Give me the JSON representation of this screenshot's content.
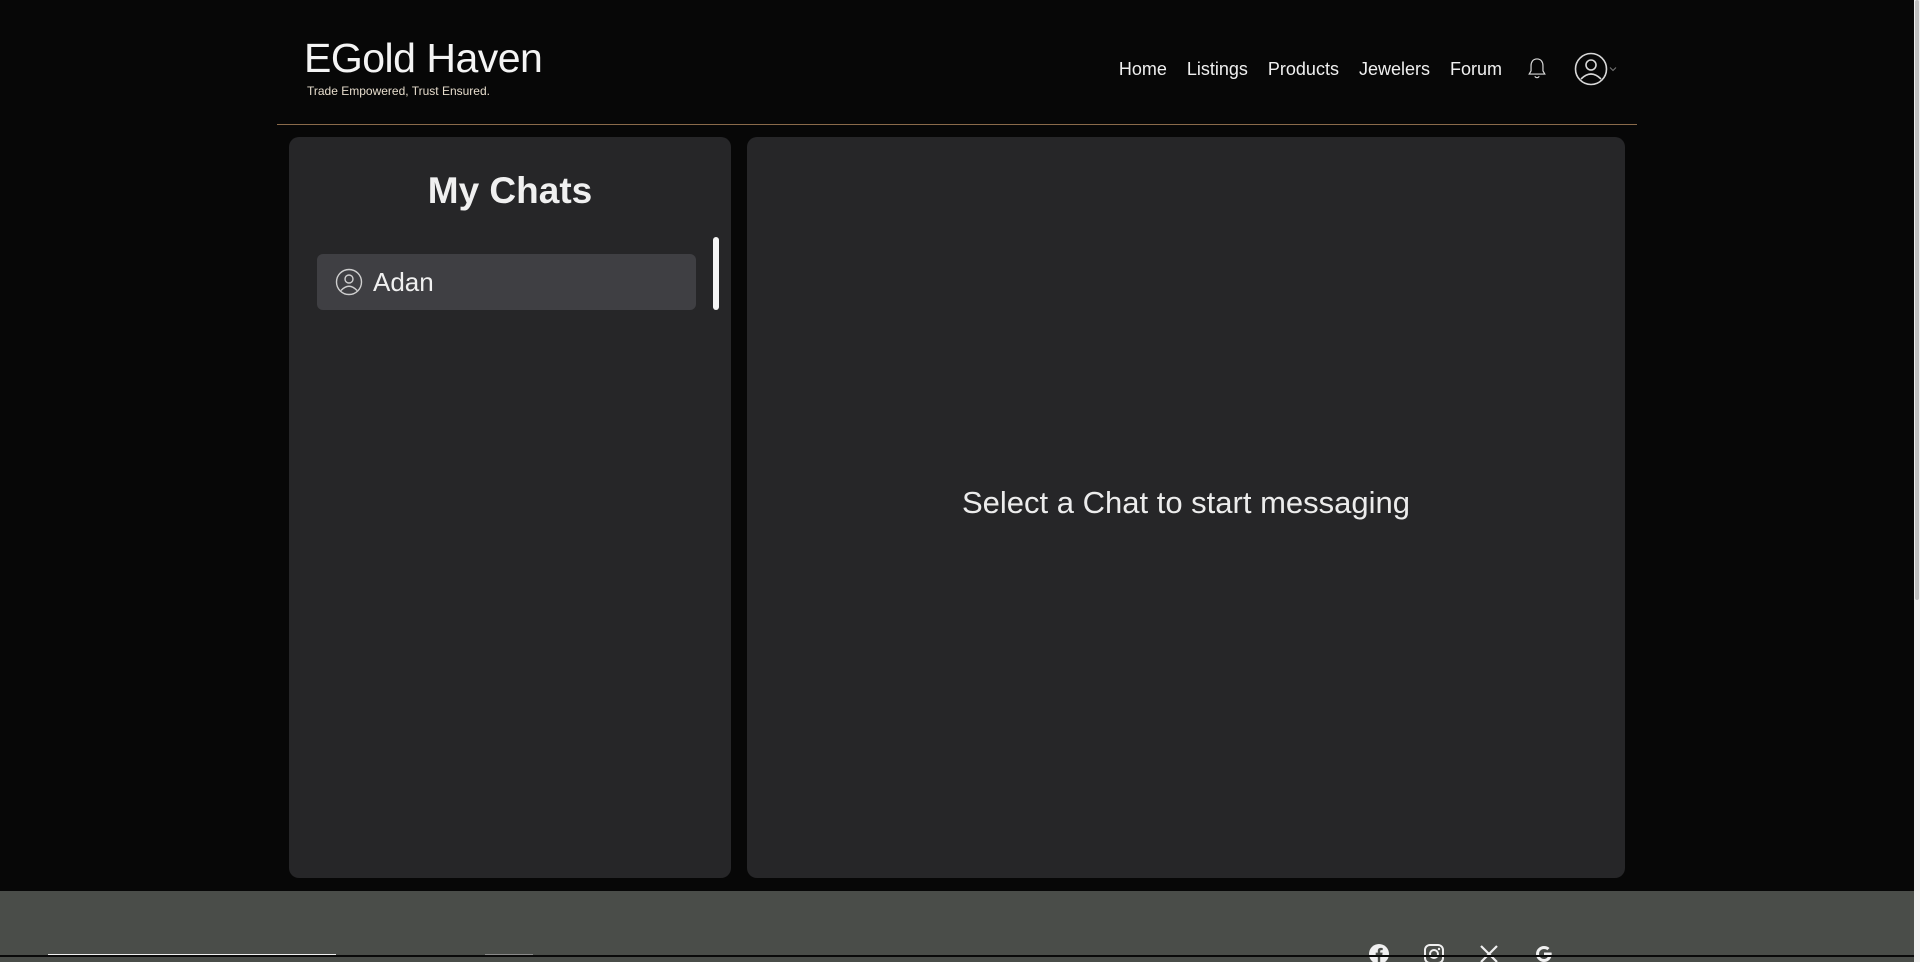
{
  "header": {
    "brand_title": "EGold Haven",
    "brand_tagline": "Trade Empowered, Trust Ensured.",
    "nav": [
      "Home",
      "Listings",
      "Products",
      "Jewelers",
      "Forum"
    ],
    "icons": {
      "notifications": "bell-icon",
      "user": "user-circle-icon",
      "dropdown": "chevron-down-icon"
    }
  },
  "sidebar": {
    "title": "My Chats",
    "chats": [
      {
        "name": "Adan",
        "icon": "user-circle-icon"
      }
    ]
  },
  "main": {
    "empty_message": "Select a Chat to start messaging"
  },
  "footer": {
    "socials": [
      "facebook-icon",
      "instagram-icon",
      "x-icon",
      "google-icon"
    ]
  },
  "colors": {
    "background": "#070707",
    "panel": "#262628",
    "chat_item": "#3f3f43",
    "divider": "#8a6a4a",
    "footer": "#4a4d49"
  }
}
